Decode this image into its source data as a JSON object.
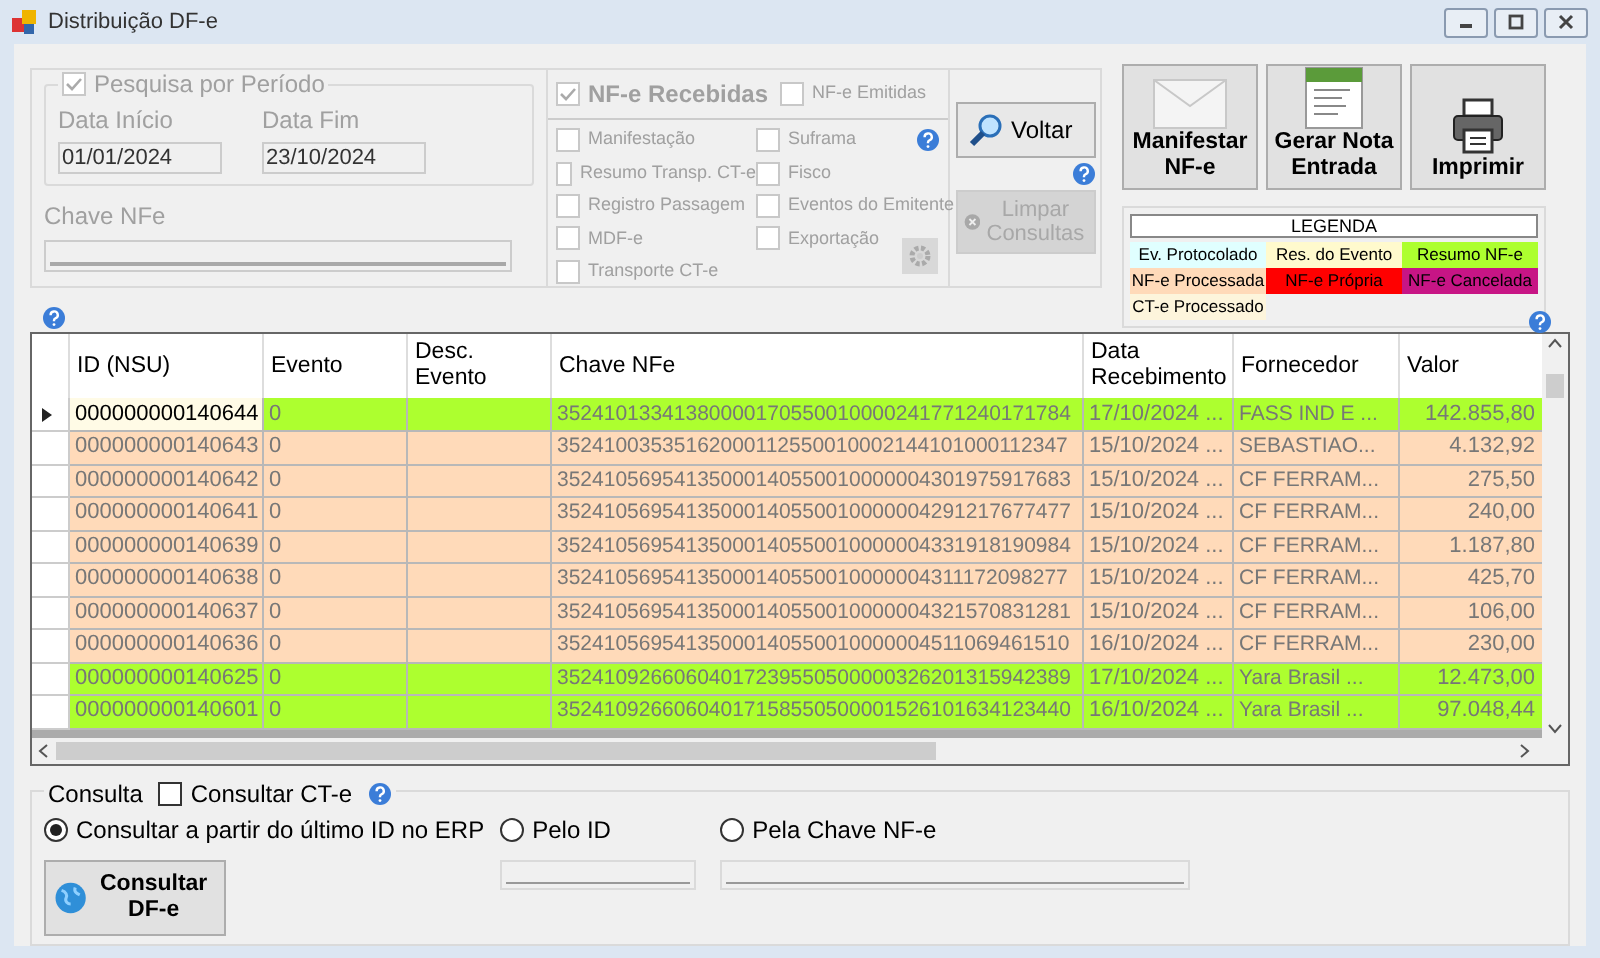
{
  "window": {
    "title": "Distribuição DF-e"
  },
  "periodo": {
    "label": "Pesquisa por Período",
    "checked": true,
    "disabled": true,
    "data_inicio": {
      "label": "Data Início",
      "value": "01/01/2024"
    },
    "data_fim": {
      "label": "Data Fim",
      "value": "23/10/2024"
    },
    "chave": {
      "label": "Chave NFe"
    }
  },
  "tipos": [
    {
      "label": "NF-e Recebidas",
      "checked": true
    },
    {
      "label": "NF-e Emitidas",
      "checked": false
    }
  ],
  "eventos": [
    {
      "label": "Manifestação",
      "checked": false
    },
    {
      "label": "Suframa",
      "checked": false
    },
    {
      "label": "Resumo Transp. CT-e",
      "checked": false
    },
    {
      "label": "Fisco",
      "checked": false
    },
    {
      "label": "Registro Passagem",
      "checked": false
    },
    {
      "label": "Eventos do Emitente",
      "checked": false
    },
    {
      "label": "MDF-e",
      "checked": false
    },
    {
      "label": "Exportação",
      "checked": false
    },
    {
      "label": "Transporte CT-e",
      "checked": false
    }
  ],
  "voltar": {
    "label": "Voltar",
    "disabled": false
  },
  "limpar": {
    "label": "Limpar Consultas",
    "disabled": true
  },
  "actions": [
    {
      "kind": "mail",
      "label": "Manifestar NF-e"
    },
    {
      "kind": "xml",
      "label": "Gerar Nota Entrada"
    },
    {
      "kind": "print",
      "label": "Imprimir"
    }
  ],
  "legenda": {
    "title": "LEGENDA",
    "items": [
      {
        "label": "Ev. Protocolado",
        "color": "#e0ffff"
      },
      {
        "label": "Res. do Evento",
        "color": "#fffacd"
      },
      {
        "label": "Resumo NF-e",
        "color": "#adff2f"
      },
      {
        "label": "NF-e Processada",
        "color": "#ffdab9"
      },
      {
        "label": "NF-e Própria",
        "color": "#ff0000"
      },
      {
        "label": "NF-e Cancelada",
        "color": "#c71585"
      },
      {
        "label": "CT-e Processado",
        "color": "#fdf5dc"
      }
    ]
  },
  "table": {
    "columns": [
      "ID (NSU)",
      "Evento",
      "Desc. Evento",
      "Chave NFe",
      "Data Recebimento",
      "Fornecedor",
      "Valor"
    ],
    "rows": [
      {
        "selected": true,
        "color": "#adff2f",
        "cells": [
          "000000000140644",
          "0",
          "",
          "35241013341380000170550010000241771240171784",
          "17/10/2024 ...",
          "FASS IND E ...",
          "142.855,80"
        ]
      },
      {
        "selected": false,
        "color": "#ffdab9",
        "cells": [
          "000000000140643",
          "0",
          "",
          "35241003535162000112550010002144101000112347",
          "15/10/2024 ...",
          "SEBASTIAO...",
          "4.132,92"
        ]
      },
      {
        "selected": false,
        "color": "#ffdab9",
        "cells": [
          "000000000140642",
          "0",
          "",
          "35241056954135000140550010000004301975917683",
          "15/10/2024 ...",
          "CF FERRAM...",
          "275,50"
        ]
      },
      {
        "selected": false,
        "color": "#ffdab9",
        "cells": [
          "000000000140641",
          "0",
          "",
          "35241056954135000140550010000004291217677477",
          "15/10/2024 ...",
          "CF FERRAM...",
          "240,00"
        ]
      },
      {
        "selected": false,
        "color": "#ffdab9",
        "cells": [
          "000000000140639",
          "0",
          "",
          "35241056954135000140550010000004331918190984",
          "15/10/2024 ...",
          "CF FERRAM...",
          "1.187,80"
        ]
      },
      {
        "selected": false,
        "color": "#ffdab9",
        "cells": [
          "000000000140638",
          "0",
          "",
          "35241056954135000140550010000004311172098277",
          "15/10/2024 ...",
          "CF FERRAM...",
          "425,70"
        ]
      },
      {
        "selected": false,
        "color": "#ffdab9",
        "cells": [
          "000000000140637",
          "0",
          "",
          "35241056954135000140550010000004321570831281",
          "15/10/2024 ...",
          "CF FERRAM...",
          "106,00"
        ]
      },
      {
        "selected": false,
        "color": "#ffdab9",
        "cells": [
          "000000000140636",
          "0",
          "",
          "35241056954135000140550010000004511069461510",
          "16/10/2024 ...",
          "CF FERRAM...",
          "230,00"
        ]
      },
      {
        "selected": false,
        "color": "#adff2f",
        "cells": [
          "000000000140625",
          "0",
          "",
          "35241092660604017239550500000326201315942389",
          "17/10/2024 ...",
          "Yara Brasil ...",
          "12.473,00"
        ]
      },
      {
        "selected": false,
        "color": "#adff2f",
        "cells": [
          "000000000140601",
          "0",
          "",
          "35241092660604017158550500001526101634123440",
          "16/10/2024 ...",
          "Yara Brasil ...",
          "97.048,44"
        ]
      }
    ]
  },
  "consulta": {
    "title": "Consulta",
    "consultar_cte": {
      "label": "Consultar CT-e",
      "checked": false
    },
    "modes": [
      {
        "label": "Consultar a partir do último ID no ERP",
        "selected": true
      },
      {
        "label": "Pelo ID",
        "selected": false
      },
      {
        "label": "Pela Chave NF-e",
        "selected": false
      }
    ],
    "button": "Consultar DF-e"
  }
}
